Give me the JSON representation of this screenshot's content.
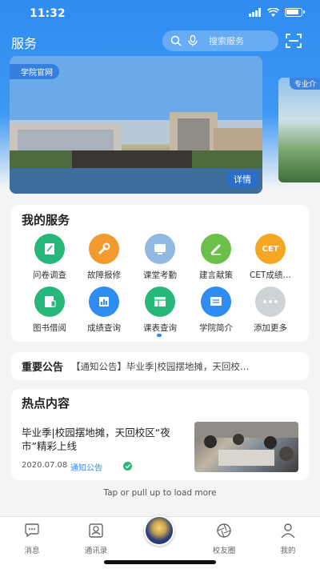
{
  "status_bar": {
    "time": "11:32"
  },
  "header": {
    "title": "服务",
    "search_placeholder": "搜索服务"
  },
  "banner": {
    "tag": "学院官网",
    "detail_label": "详情",
    "side_tag": "专业介"
  },
  "services": {
    "title": "我的服务",
    "items": [
      {
        "label": "问卷调查",
        "icon": "survey-icon",
        "color": "#27b77a",
        "glyph": "✎"
      },
      {
        "label": "故障报修",
        "icon": "wrench-icon",
        "color": "#f39a2e",
        "glyph": "🔧"
      },
      {
        "label": "课堂考勤",
        "icon": "monitor-icon",
        "color": "#8fb9e0",
        "glyph": "▭"
      },
      {
        "label": "建言献策",
        "icon": "pencil-icon",
        "color": "#6cc04a",
        "glyph": "✎"
      },
      {
        "label": "CET成绩…",
        "icon": "cet-icon",
        "color": "#f5a623",
        "glyph": "CET"
      },
      {
        "label": "图书借阅",
        "icon": "book-icon",
        "color": "#27b77a",
        "glyph": "▤"
      },
      {
        "label": "成绩查询",
        "icon": "score-icon",
        "color": "#2f8cf0",
        "glyph": "▦"
      },
      {
        "label": "课表查询",
        "icon": "timetable-icon",
        "color": "#27b77a",
        "glyph": "▤"
      },
      {
        "label": "学院简介",
        "icon": "intro-icon",
        "color": "#2f8cf0",
        "glyph": "☰"
      },
      {
        "label": "添加更多",
        "icon": "more-icon",
        "color": "#cfd3d8",
        "glyph": "•••"
      }
    ]
  },
  "notice": {
    "title": "重要公告",
    "text": "【通知公告】毕业季|校园摆地摊，天回校…"
  },
  "hot": {
    "title": "热点内容",
    "news_title": "毕业季|校园摆地摊，天回校区“夜市”精彩上线",
    "date": "2020.07.08",
    "category": "通知公告"
  },
  "load_more": "Tap or pull up to load more",
  "tabs": [
    {
      "label": "消息",
      "icon": "message-icon"
    },
    {
      "label": "通讯录",
      "icon": "contacts-icon"
    },
    {
      "label": "",
      "icon": "campus-logo-icon"
    },
    {
      "label": "校友圈",
      "icon": "aperture-icon"
    },
    {
      "label": "我的",
      "icon": "person-icon"
    }
  ]
}
